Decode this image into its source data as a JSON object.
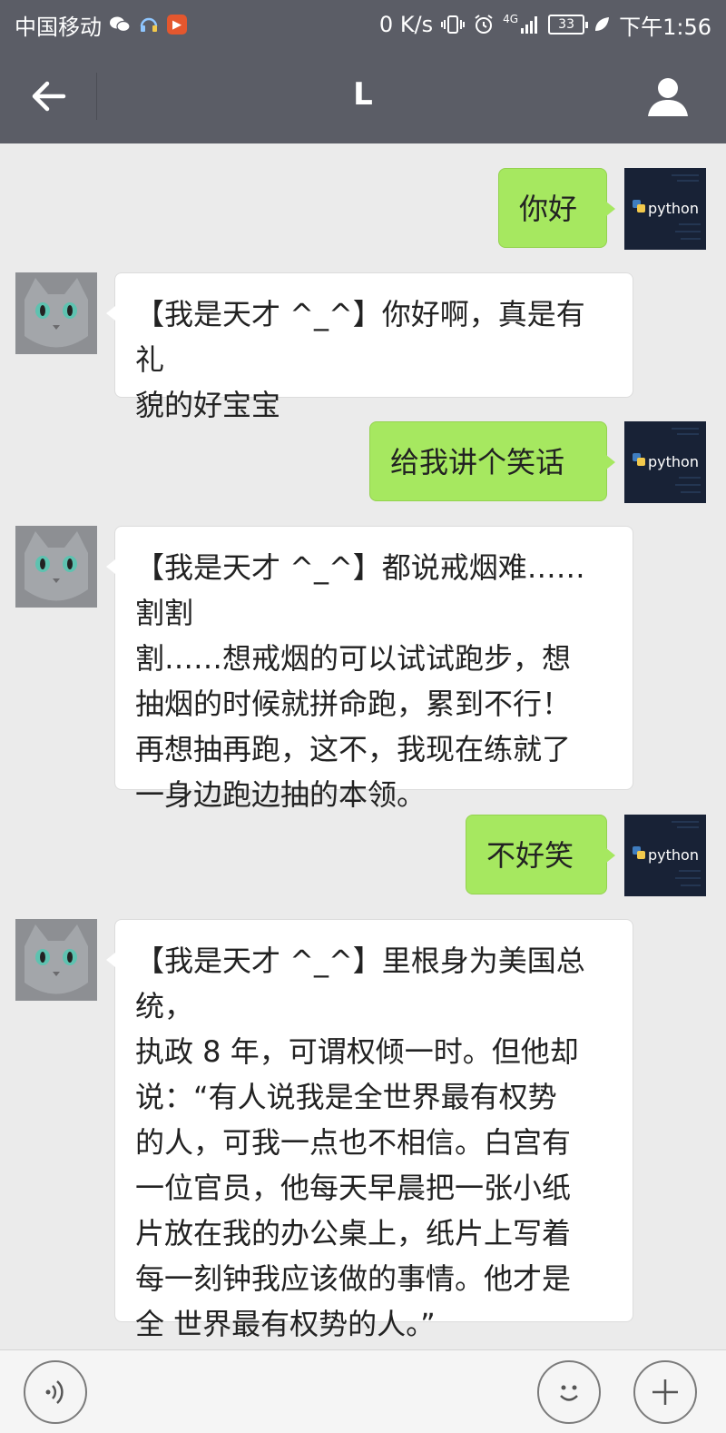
{
  "status_bar": {
    "carrier": "中国移动",
    "network_speed": "0 K/s",
    "signal_type": "4G",
    "battery": "33",
    "time": "下午1:56",
    "icons": [
      "wechat-icon",
      "headset-app-icon",
      "video-app-icon",
      "vibrate-icon",
      "alarm-icon",
      "signal-icon",
      "leaf-icon"
    ]
  },
  "nav": {
    "title": "L",
    "back_icon": "arrow-left-icon",
    "profile_icon": "person-icon"
  },
  "avatars": {
    "me_label": "python",
    "bot": "cat"
  },
  "messages": [
    {
      "sender": "me",
      "text": "你好"
    },
    {
      "sender": "bot",
      "lines": [
        "【我是天才 ^_^】你好啊，真是有礼",
        "貌的好宝宝"
      ]
    },
    {
      "sender": "me",
      "text": "给我讲个笑话"
    },
    {
      "sender": "bot",
      "lines": [
        "【我是天才 ^_^】都说戒烟难……割割",
        "割……想戒烟的可以试试跑步，想",
        "抽烟的时候就拼命跑，累到不行！",
        "再想抽再跑，这不，我现在练就了",
        "一身边跑边抽的本领。"
      ]
    },
    {
      "sender": "me",
      "text": "不好笑"
    },
    {
      "sender": "bot",
      "lines": [
        "【我是天才 ^_^】里根身为美国总统，",
        "执政 8 年，可谓权倾一时。但他却",
        "说：“有人说我是全世界最有权势",
        "的人，可我一点也不相信。白宫有",
        "一位官员，他每天早晨把一张小纸",
        "片放在我的办公桌上，纸片上写着",
        "每一刻钟我应该做的事情。他才是",
        "全 世界最有权势的人。”"
      ]
    }
  ],
  "input_bar": {
    "voice_icon": "voice-icon",
    "emoji_icon": "emoji-icon",
    "more_icon": "plus-icon"
  },
  "colors": {
    "nav_bg": "#5b5d66",
    "chat_bg": "#ebebeb",
    "my_bubble": "#a6e860",
    "bot_bubble": "#ffffff"
  }
}
